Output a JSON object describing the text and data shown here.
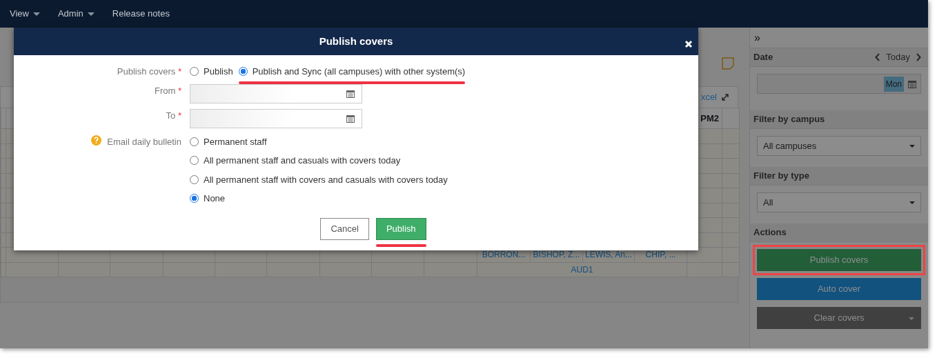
{
  "navbar": {
    "items": [
      {
        "label": "View",
        "dropdown": true
      },
      {
        "label": "Admin",
        "dropdown": true
      },
      {
        "label": "Release notes",
        "dropdown": false
      }
    ]
  },
  "grid": {
    "export_link": "xcel",
    "last_column": "PM2",
    "staff_row": [
      "BORRON...",
      "BISHOP, Z...",
      "LEWIS, An...",
      "CHIP, ..."
    ],
    "room": "AUD1"
  },
  "sidebar": {
    "collapse": "»",
    "date": {
      "title": "Date",
      "today": "Today",
      "day_badge": "Mon"
    },
    "campus": {
      "title": "Filter by campus",
      "value": "All campuses"
    },
    "type": {
      "title": "Filter by type",
      "value": "All"
    },
    "actions": {
      "title": "Actions",
      "buttons": [
        {
          "label": "Publish covers",
          "kind": "success",
          "highlighted": true,
          "dropdown": false
        },
        {
          "label": "Auto cover",
          "kind": "primary",
          "highlighted": false,
          "dropdown": false
        },
        {
          "label": "Clear covers",
          "kind": "dark",
          "highlighted": false,
          "dropdown": true
        }
      ]
    }
  },
  "modal": {
    "title": "Publish covers",
    "publish": {
      "label": "Publish covers",
      "required_mark": "*",
      "options": [
        {
          "label": "Publish",
          "selected": false,
          "underlined": false
        },
        {
          "label": "Publish and Sync (all campuses) with other system(s)",
          "selected": true,
          "underlined": true
        }
      ]
    },
    "dates": [
      {
        "label": "From",
        "required_mark": "*"
      },
      {
        "label": "To",
        "required_mark": "*"
      }
    ],
    "bulletin": {
      "label": "Email daily bulletin",
      "help": true,
      "options": [
        {
          "label": "Permanent staff",
          "selected": false
        },
        {
          "label": "All permanent staff and casuals with covers today",
          "selected": false
        },
        {
          "label": "All permanent staff with covers and casuals with covers today",
          "selected": false
        },
        {
          "label": "None",
          "selected": true
        }
      ]
    },
    "buttons": [
      {
        "label": "Cancel",
        "kind": "secondary",
        "underlined": false
      },
      {
        "label": "Publish",
        "kind": "success",
        "underlined": true
      }
    ]
  }
}
